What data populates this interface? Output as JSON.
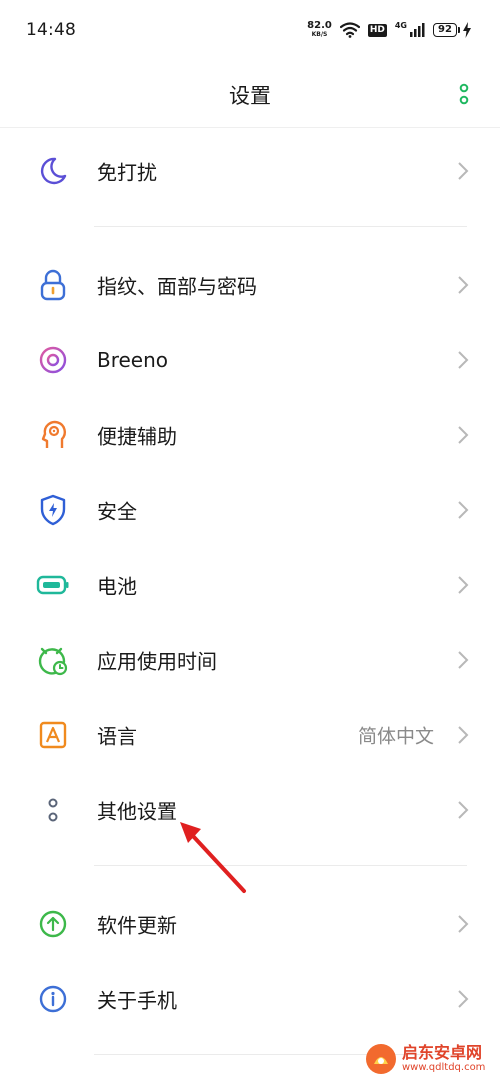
{
  "status_bar": {
    "time": "14:48",
    "net_speed": "82.0",
    "net_unit": "KB/S",
    "hd": "HD",
    "network": "4G",
    "battery": "92"
  },
  "header": {
    "title": "设置"
  },
  "items": [
    {
      "label": "免打扰",
      "icon": "moon-icon",
      "color": "#5b4fd6"
    },
    {
      "label": "指纹、面部与密码",
      "icon": "lock-icon",
      "color": "#3d6fd6"
    },
    {
      "label": "Breeno",
      "icon": "breeno-icon",
      "color": "#c94fc9"
    },
    {
      "label": "便捷辅助",
      "icon": "assist-head-icon",
      "color": "#f07a2e"
    },
    {
      "label": "安全",
      "icon": "shield-bolt-icon",
      "color": "#2f5fd6"
    },
    {
      "label": "电池",
      "icon": "battery-icon",
      "color": "#1fb89a"
    },
    {
      "label": "应用使用时间",
      "icon": "alarm-clock-icon",
      "color": "#3db84a"
    },
    {
      "label": "语言",
      "value": "简体中文",
      "icon": "language-a-icon",
      "color": "#f08a1e"
    },
    {
      "label": "其他设置",
      "icon": "more-settings-icon",
      "color": "#5a6478"
    },
    {
      "label": "软件更新",
      "icon": "update-arrow-icon",
      "color": "#3db84a"
    },
    {
      "label": "关于手机",
      "icon": "info-icon",
      "color": "#3d6fd6"
    }
  ],
  "watermark": {
    "name": "启东安卓网",
    "url": "www.qdltdq.com"
  },
  "colors": {
    "accent_green": "#1fb860",
    "annotation_arrow": "#e02020"
  }
}
